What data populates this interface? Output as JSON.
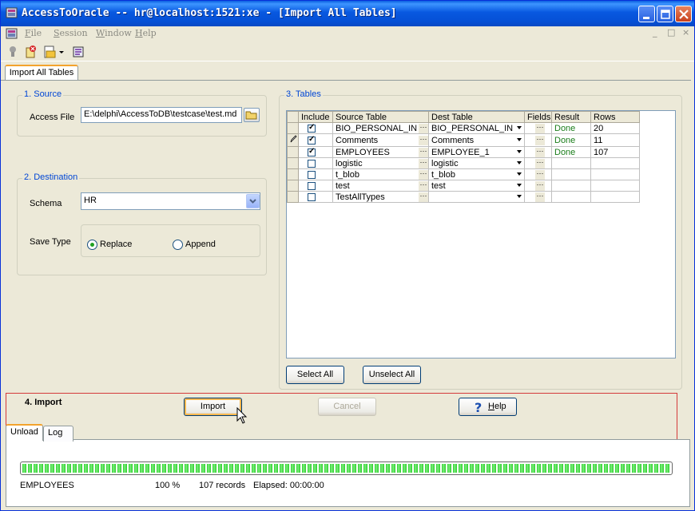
{
  "window": {
    "title": "AccessToOracle -- hr@localhost:1521:xe - [Import All Tables]"
  },
  "menu": [
    {
      "label": "File",
      "mnemonic": "F",
      "rest": "ile"
    },
    {
      "label": "Session",
      "mnemonic": "S",
      "rest": "ession"
    },
    {
      "label": "Window",
      "mnemonic": "W",
      "rest": "indow"
    },
    {
      "label": "Help",
      "mnemonic": "H",
      "rest": "elp"
    }
  ],
  "mdi_controls": {
    "minimize": "_",
    "restore": "□",
    "close": "×"
  },
  "toolbar": {
    "icons": [
      "connect-icon",
      "disconnect-icon",
      "open-document-icon",
      "dropdown-arrow-icon",
      "import-icon"
    ]
  },
  "document_tab": {
    "label": "Import All Tables"
  },
  "source": {
    "title": "1. Source",
    "access_file_label": "Access File",
    "access_file_value": "E:\\delphi\\AccessToDB\\testcase\\test.md"
  },
  "destination": {
    "title": "2. Destination",
    "schema_label": "Schema",
    "schema_value": "HR",
    "save_type_label": "Save Type",
    "replace_label": "Replace",
    "append_label": "Append",
    "selected": "Replace"
  },
  "tables": {
    "title": "3. Tables",
    "columns": [
      "Include",
      "Source Table",
      "Dest Table",
      "Fields",
      "Result",
      "Rows"
    ],
    "rows": [
      {
        "include": true,
        "source": "BIO_PERSONAL_INI",
        "dest": "BIO_PERSONAL_INI",
        "result": "Done",
        "rows": "20",
        "editing": false
      },
      {
        "include": true,
        "source": "Comments",
        "dest": "Comments",
        "result": "Done",
        "rows": "11",
        "editing": true
      },
      {
        "include": true,
        "source": "EMPLOYEES",
        "dest": "EMPLOYEE_1",
        "result": "Done",
        "rows": "107",
        "editing": false
      },
      {
        "include": false,
        "source": "logistic",
        "dest": "logistic",
        "result": "",
        "rows": "",
        "editing": false
      },
      {
        "include": false,
        "source": "t_blob",
        "dest": "t_blob",
        "result": "",
        "rows": "",
        "editing": false
      },
      {
        "include": false,
        "source": "test",
        "dest": "test",
        "result": "",
        "rows": "",
        "editing": false
      },
      {
        "include": false,
        "source": "TestAllTypes",
        "dest": "",
        "result": "",
        "rows": "",
        "editing": false
      }
    ],
    "ellipsis": "···",
    "select_all_label": "Select All",
    "unselect_all_label": "Unselect All"
  },
  "import_section": {
    "title": "4. Import",
    "import_label": "Import",
    "cancel_label": "Cancel",
    "help_label": "Help",
    "help_mnemonic": "H",
    "help_rest": "elp",
    "tabs": [
      "Unload",
      "Log"
    ],
    "active_tab": "Unload",
    "progress_percent": 100,
    "status_table": "EMPLOYEES",
    "status_percent": "100 %",
    "status_records": "107 records",
    "status_elapsed": "Elapsed: 00:00:00"
  },
  "colors": {
    "titlebar": "#0858e0",
    "group_title": "#0046d5",
    "done": "#1b7d1b",
    "progress": "#2ccc2c",
    "import_frame": "#d43a3a"
  }
}
